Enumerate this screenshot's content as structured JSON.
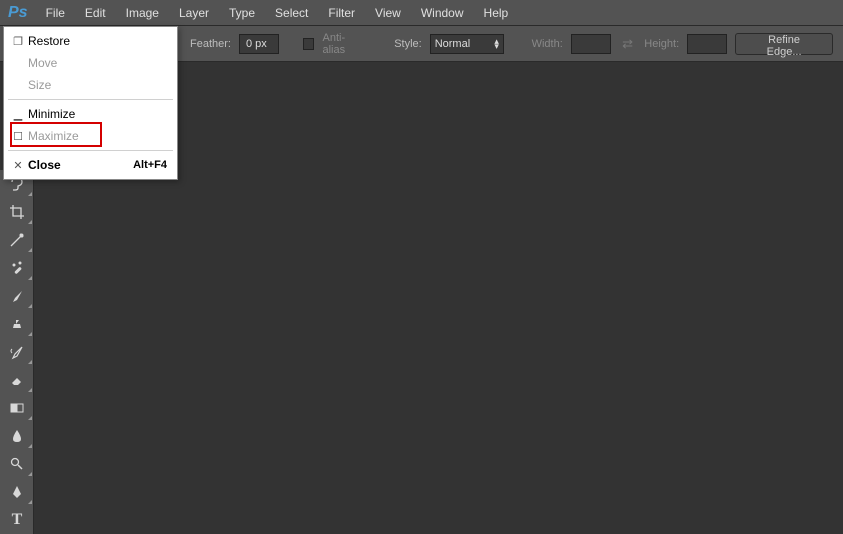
{
  "app": {
    "logo": "Ps"
  },
  "menubar": [
    "File",
    "Edit",
    "Image",
    "Layer",
    "Type",
    "Select",
    "Filter",
    "View",
    "Window",
    "Help"
  ],
  "options": {
    "feather_label": "Feather:",
    "feather_value": "0 px",
    "antialias_label": "Anti-alias",
    "style_label": "Style:",
    "style_value": "Normal",
    "width_label": "Width:",
    "width_value": "",
    "height_label": "Height:",
    "height_value": "",
    "refine_label": "Refine Edge..."
  },
  "dropmenu": {
    "items": [
      {
        "icon": "restore",
        "label": "Restore",
        "disabled": false
      },
      {
        "icon": "",
        "label": "Move",
        "disabled": true
      },
      {
        "icon": "",
        "label": "Size",
        "disabled": true
      },
      {
        "sep": true
      },
      {
        "icon": "minimize",
        "label": "Minimize",
        "disabled": false,
        "highlight": true
      },
      {
        "icon": "maximize",
        "label": "Maximize",
        "disabled": true
      },
      {
        "sep": true
      },
      {
        "icon": "close",
        "label": "Close",
        "disabled": false,
        "shortcut": "Alt+F4",
        "bold": true
      }
    ]
  },
  "tools": [
    "lasso",
    "crop",
    "eyedropper",
    "healing-brush",
    "brush",
    "clone-stamp",
    "history-brush",
    "eraser",
    "gradient",
    "blur",
    "dodge",
    "pen",
    "type"
  ]
}
